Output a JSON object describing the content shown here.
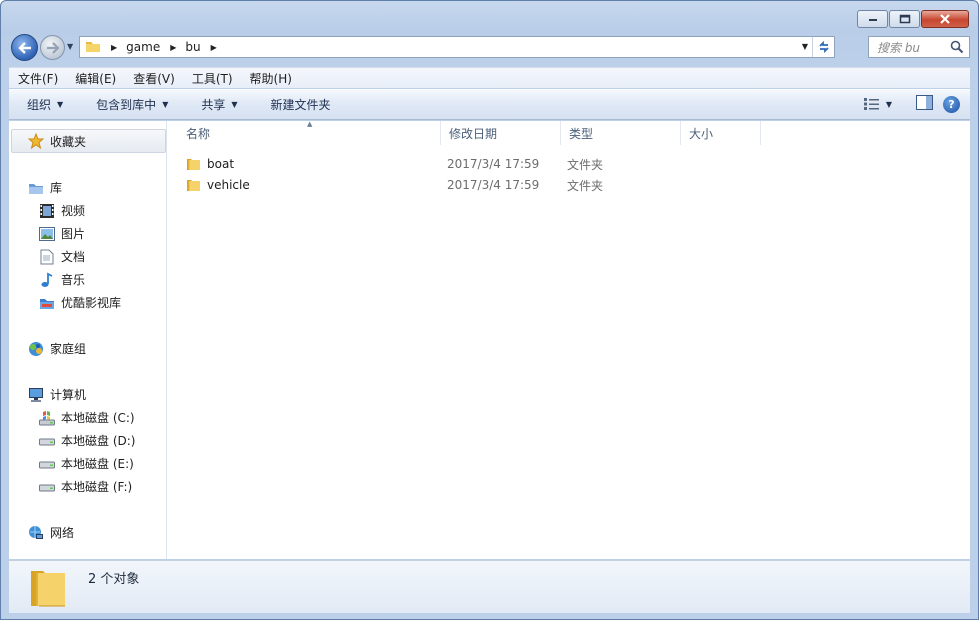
{
  "address": {
    "crumbs": [
      "game",
      "bu"
    ]
  },
  "search": {
    "placeholder": "搜索 bu"
  },
  "menubar": {
    "items": [
      "文件(F)",
      "编辑(E)",
      "查看(V)",
      "工具(T)",
      "帮助(H)"
    ]
  },
  "commands": {
    "organize": "组织",
    "include_library": "包含到库中",
    "share": "共享",
    "new_folder": "新建文件夹"
  },
  "nav": {
    "favorites": "收藏夹",
    "libraries": "库",
    "library_items": [
      "视频",
      "图片",
      "文档",
      "音乐",
      "优酷影视库"
    ],
    "homegroup": "家庭组",
    "computer": "计算机",
    "drives": [
      "本地磁盘 (C:)",
      "本地磁盘 (D:)",
      "本地磁盘 (E:)",
      "本地磁盘 (F:)"
    ],
    "network": "网络"
  },
  "columns": {
    "name": "名称",
    "modified": "修改日期",
    "type": "类型",
    "size": "大小"
  },
  "files": [
    {
      "name": "boat",
      "modified": "2017/3/4 17:59",
      "type": "文件夹"
    },
    {
      "name": "vehicle",
      "modified": "2017/3/4 17:59",
      "type": "文件夹"
    }
  ],
  "details": {
    "count": "2 个对象"
  },
  "colors": {
    "frame": "#bcd0ea",
    "accent_blue": "#2f62b5",
    "folder_yellow": "#f2c94c"
  }
}
